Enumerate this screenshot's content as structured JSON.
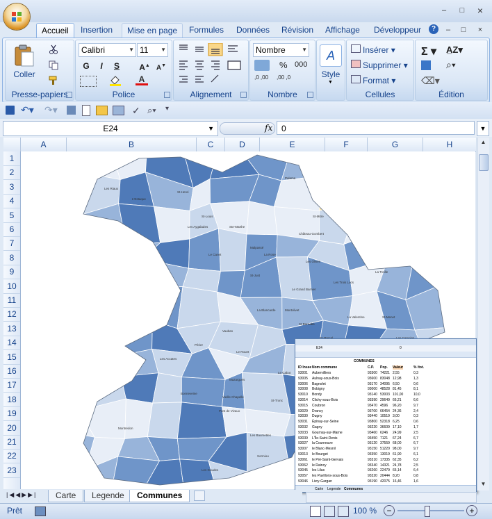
{
  "window": {
    "minimize": "–",
    "maximize": "□",
    "close": "×"
  },
  "tabs": [
    "Accueil",
    "Insertion",
    "Mise en page",
    "Formules",
    "Données",
    "Révision",
    "Affichage",
    "Développeur"
  ],
  "ribbon_controls": {
    "min": "–",
    "restore": "□",
    "close": "×"
  },
  "clipboard": {
    "paste_label": "Coller",
    "group": "Presse-papiers"
  },
  "font": {
    "name": "Calibri",
    "size": "11",
    "bold": "G",
    "italic": "I",
    "underline": "S",
    "group": "Police"
  },
  "alignment": {
    "group": "Alignement"
  },
  "number": {
    "format": "Nombre",
    "percent": "%",
    "thousands": "000",
    "dec_inc": ",0 ,00",
    "dec_dec": ",00 ,0",
    "group": "Nombre"
  },
  "style": {
    "label": "Style"
  },
  "cells": {
    "insert": "Insérer",
    "delete": "Supprimer",
    "format": "Format",
    "group": "Cellules"
  },
  "editing": {
    "group": "Édition"
  },
  "formula_bar": {
    "name_box": "E24",
    "fx": "fx",
    "value": "0"
  },
  "columns": [
    "A",
    "B",
    "C",
    "D",
    "E",
    "F",
    "G",
    "H"
  ],
  "rows": [
    "1",
    "2",
    "3",
    "4",
    "5",
    "6",
    "7",
    "8",
    "9",
    "10",
    "11",
    "12",
    "13",
    "14",
    "15",
    "16",
    "17",
    "18",
    "19",
    "20",
    "21",
    "22",
    "23"
  ],
  "sheets": [
    "Carte",
    "Legende",
    "Communes"
  ],
  "active_sheet": "Communes",
  "status": {
    "ready": "Prêt",
    "zoom": "100 %"
  },
  "map_labels": [
    "Les Riaux",
    "L'Estaque",
    "St-Henri",
    "St-Louis",
    "Ste-Marthe",
    "Les Aygalades",
    "Le Canet",
    "Malpassé",
    "La Rose",
    "Château-Gombert",
    "Palama",
    "St-Mitre",
    "Les Olives",
    "Le Grand Barnier",
    "St-Just",
    "La Blancarde",
    "Les Trois Lucs",
    "La Treille",
    "St-Menet",
    "La Valentine",
    "Les Camoins",
    "St-Marcel",
    "St-Barnabé",
    "Montolivet",
    "Le Rouet",
    "Vauban",
    "Périer",
    "Mazargues",
    "Les Goudes",
    "Montredon",
    "Vieille Chapelle",
    "Pont de Vivaux",
    "Les Baumettes",
    "St-Tronc",
    "Bonneveine",
    "Le Cabot",
    "Sormiou",
    "Les Accates"
  ],
  "colors": {
    "light": "#e8eef7",
    "pale": "#c9d8ec",
    "mid": "#98b4da",
    "strong": "#6f95c9",
    "dark": "#4f7ab8",
    "highlight": "#f8e7b3"
  },
  "inset": {
    "name_box": "E24",
    "value": "0",
    "title": "COMMUNES",
    "headers": [
      "ID Insee",
      "Nom commune",
      "C.P.",
      "Pop.",
      "Valeur",
      "% /tot."
    ],
    "rows": [
      [
        "93001",
        "Aubervilliers",
        "93300",
        "74221",
        "2,55",
        "0,3"
      ],
      [
        "93005",
        "Aulnay-sous-Bois",
        "93600",
        "83048",
        "12,98",
        "1,3"
      ],
      [
        "93006",
        "Bagnolet",
        "93170",
        "34095",
        "6,50",
        "0,6"
      ],
      [
        "93008",
        "Bobigny",
        "93000",
        "48528",
        "81,45",
        "8,1"
      ],
      [
        "93010",
        "Bondy",
        "93140",
        "53003",
        "101,00",
        "10,0"
      ],
      [
        "93014",
        "Clichy-sous-Bois",
        "93390",
        "29649",
        "66,21",
        "6,6"
      ],
      [
        "93015",
        "Coubron",
        "93470",
        "4596",
        "96,20",
        "9,7"
      ],
      [
        "93029",
        "Drancy",
        "93700",
        "66454",
        "24,36",
        "2,4"
      ],
      [
        "93030",
        "Dugny",
        "93440",
        "10519",
        "3,00",
        "0,3"
      ],
      [
        "93031",
        "Épinay-sur-Seine",
        "93800",
        "52318",
        "6,25",
        "0,6"
      ],
      [
        "93032",
        "Gagny",
        "93220",
        "36609",
        "17,10",
        "1,7"
      ],
      [
        "93033",
        "Gournay-sur-Marne",
        "93460",
        "6246",
        "24,99",
        "2,5"
      ],
      [
        "93039",
        "L'Île-Saint-Denis",
        "93450",
        "7121",
        "67,24",
        "6,7"
      ],
      [
        "93027",
        "la Courneuve",
        "93120",
        "37559",
        "68,00",
        "6,7"
      ],
      [
        "93007",
        "le Blanc-Mesnil",
        "93150",
        "51220",
        "98,00",
        "9,7"
      ],
      [
        "93013",
        "le Bourget",
        "93350",
        "13019",
        "61,90",
        "6,1"
      ],
      [
        "93061",
        "le Pré-Saint-Gervais",
        "93310",
        "17335",
        "62,35",
        "6,2"
      ],
      [
        "93062",
        "le Raincy",
        "93340",
        "14321",
        "24,78",
        "2,5"
      ],
      [
        "93045",
        "les Lilas",
        "93260",
        "22479",
        "65,14",
        "6,4"
      ],
      [
        "93057",
        "les Pavillons-sous-Bois",
        "93320",
        "20444",
        "8,20",
        "0,8"
      ],
      [
        "93046",
        "Livry-Gargan",
        "93190",
        "42075",
        "16,46",
        "1,6"
      ]
    ],
    "sheets": [
      "Carte",
      "Legende",
      "Communes"
    ]
  }
}
